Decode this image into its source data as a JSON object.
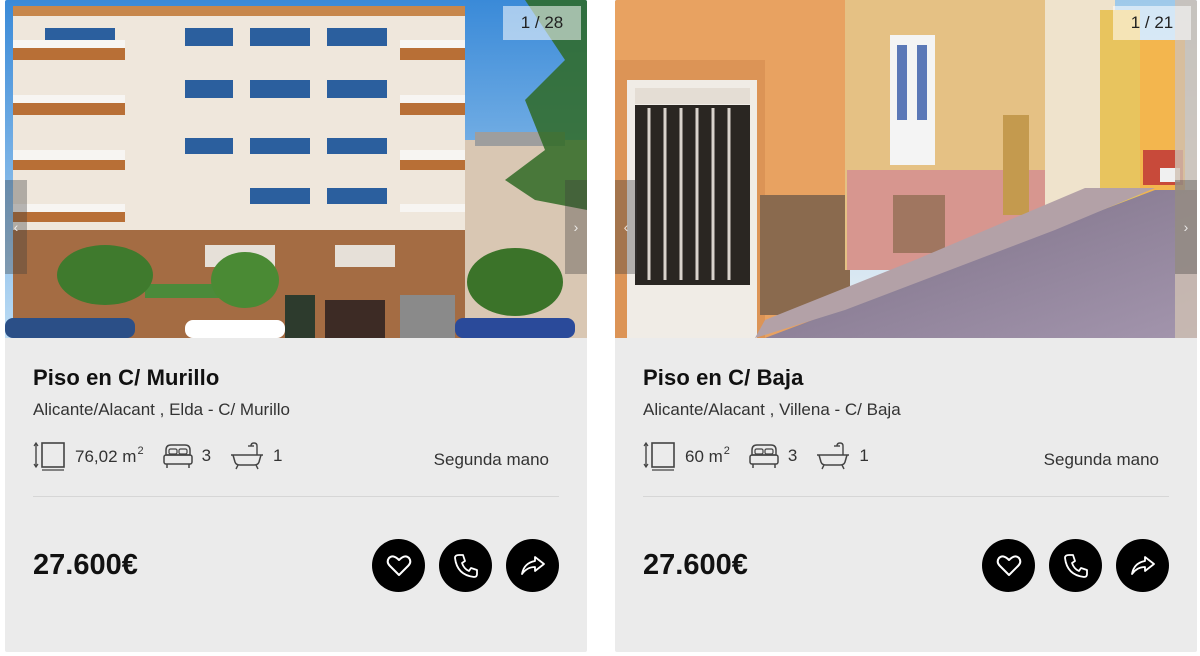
{
  "listings": [
    {
      "photo": {
        "counter": "1 / 28",
        "prev_glyph": "‹",
        "next_glyph": "›"
      },
      "title": "Piso en C/ Murillo",
      "location": "Alicante/Alacant , Elda - C/ Murillo",
      "area_value": "76,02 m",
      "area_sup": "2",
      "bedrooms": "3",
      "bathrooms": "1",
      "condition": "Segunda mano",
      "price": "27.600€"
    },
    {
      "photo": {
        "counter": "1 / 21",
        "prev_glyph": "‹",
        "next_glyph": "›"
      },
      "title": "Piso en C/ Baja",
      "location": "Alicante/Alacant , Villena - C/ Baja",
      "area_value": "60 m",
      "area_sup": "2",
      "bedrooms": "3",
      "bathrooms": "1",
      "condition": "Segunda mano",
      "price": "27.600€"
    }
  ],
  "icons": {
    "area": "area-icon",
    "bed": "bed-icon",
    "bath": "bath-icon",
    "favorite": "heart-icon",
    "call": "phone-icon",
    "share": "share-icon"
  },
  "colors": {
    "card_bg": "#ebebeb",
    "button_bg": "#000000",
    "text_dark": "#111111"
  }
}
